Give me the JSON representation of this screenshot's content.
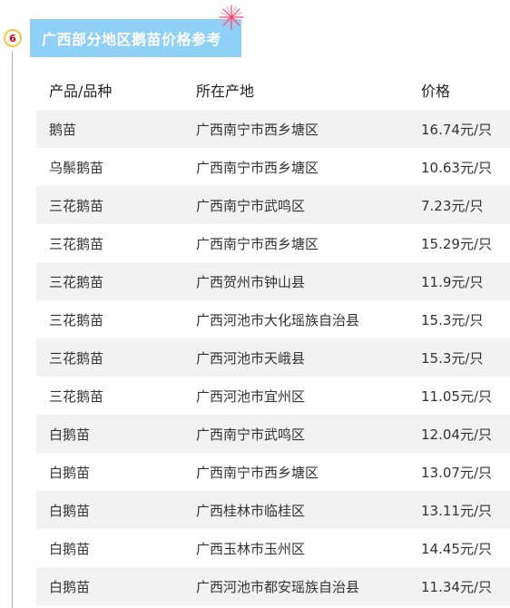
{
  "section": {
    "step_number": "6",
    "title": "广西部分地区鹅苗价格参考"
  },
  "table": {
    "headers": {
      "product": "产品/品种",
      "origin": "所在产地",
      "price": "价格"
    },
    "rows": [
      {
        "product": "鹅苗",
        "origin": "广西南宁市西乡塘区",
        "price": "16.74元/只"
      },
      {
        "product": "乌鬃鹅苗",
        "origin": "广西南宁市西乡塘区",
        "price": "10.63元/只"
      },
      {
        "product": "三花鹅苗",
        "origin": "广西南宁市武鸣区",
        "price": "7.23元/只"
      },
      {
        "product": "三花鹅苗",
        "origin": "广西南宁市西乡塘区",
        "price": "15.29元/只"
      },
      {
        "product": "三花鹅苗",
        "origin": "广西贺州市钟山县",
        "price": "11.9元/只"
      },
      {
        "product": "三花鹅苗",
        "origin": "广西河池市大化瑶族自治县",
        "price": "15.3元/只"
      },
      {
        "product": "三花鹅苗",
        "origin": "广西河池市天峨县",
        "price": "15.3元/只"
      },
      {
        "product": "三花鹅苗",
        "origin": "广西河池市宜州区",
        "price": "11.05元/只"
      },
      {
        "product": "白鹅苗",
        "origin": "广西南宁市武鸣区",
        "price": "12.04元/只"
      },
      {
        "product": "白鹅苗",
        "origin": "广西南宁市西乡塘区",
        "price": "13.07元/只"
      },
      {
        "product": "白鹅苗",
        "origin": "广西桂林市临桂区",
        "price": "13.11元/只"
      },
      {
        "product": "白鹅苗",
        "origin": "广西玉林市玉州区",
        "price": "14.45元/只"
      },
      {
        "product": "白鹅苗",
        "origin": "广西河池市都安瑶族自治县",
        "price": "11.34元/只"
      }
    ]
  },
  "colors": {
    "title_bg": "#8fd0f7",
    "row_stripe": "#f2f2f2",
    "badge_border": "#f2c94c",
    "badge_text": "#d0021b"
  },
  "icons": {
    "decoration": "firework-icon"
  }
}
